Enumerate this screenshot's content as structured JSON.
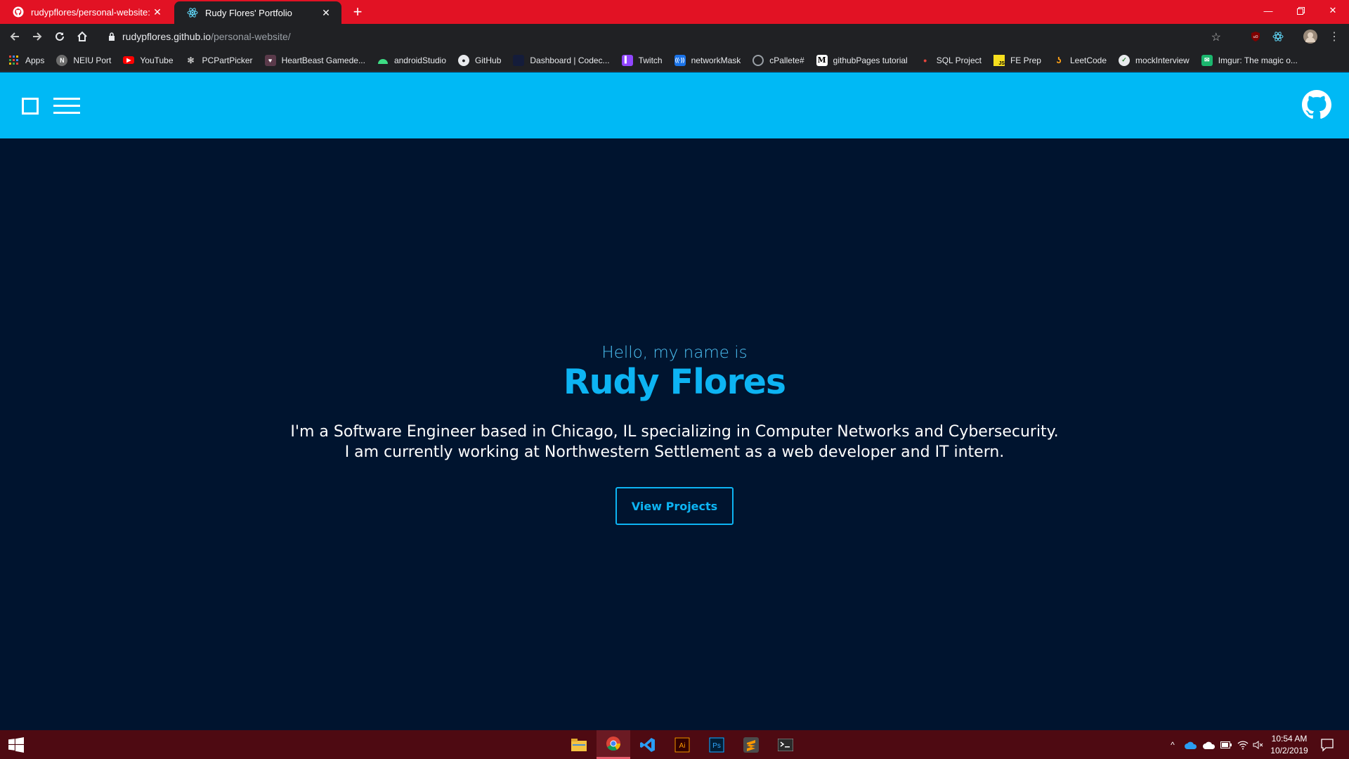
{
  "browser": {
    "tabs": [
      {
        "title": "rudypflores/personal-website: Pe",
        "favicon": "github-icon",
        "active": false
      },
      {
        "title": "Rudy Flores' Portfolio",
        "favicon": "react-icon",
        "active": true
      }
    ],
    "url_host": "rudypflores.github.io",
    "url_path": "/personal-website/",
    "bookmarks": [
      {
        "label": "Apps",
        "icon": "apps-grid-icon",
        "color": "#4285f4"
      },
      {
        "label": "NEIU Port",
        "icon": "neiu-icon",
        "color": "#9aa0a6"
      },
      {
        "label": "YouTube",
        "icon": "youtube-icon",
        "color": "#ff0000"
      },
      {
        "label": "PCPartPicker",
        "icon": "pcpartpicker-icon",
        "color": "#9aa0a6"
      },
      {
        "label": "HeartBeast Gamede...",
        "icon": "heartbeast-icon",
        "color": "#c0a0b0"
      },
      {
        "label": "androidStudio",
        "icon": "android-icon",
        "color": "#3ddc84"
      },
      {
        "label": "GitHub",
        "icon": "github-icon",
        "color": "#ffffff"
      },
      {
        "label": "Dashboard | Codec...",
        "icon": "codecademy-icon",
        "color": "#202124"
      },
      {
        "label": "Twitch",
        "icon": "twitch-icon",
        "color": "#9146ff"
      },
      {
        "label": "networkMask",
        "icon": "networkmask-icon",
        "color": "#1a73e8"
      },
      {
        "label": "cPallete#",
        "icon": "cpallete-icon",
        "color": "#9aa0a6"
      },
      {
        "label": "githubPages tutorial",
        "icon": "medium-icon",
        "color": "#ffffff"
      },
      {
        "label": "SQL Project",
        "icon": "sql-icon",
        "color": "#e8453c"
      },
      {
        "label": "FE Prep",
        "icon": "js-icon",
        "color": "#f7df1e"
      },
      {
        "label": "LeetCode",
        "icon": "leetcode-icon",
        "color": "#ffa116"
      },
      {
        "label": "mockInterview",
        "icon": "check-icon",
        "color": "#4caf50"
      },
      {
        "label": "Imgur: The magic o...",
        "icon": "imgur-icon",
        "color": "#1bb76e"
      }
    ]
  },
  "hero": {
    "greeting": "Hello, my name is",
    "name": "Rudy Flores",
    "bio_line1": "I'm a Software Engineer based in Chicago, IL specializing in Computer Networks and Cybersecurity.",
    "bio_line2": "I am currently working at Northwestern Settlement as a web developer and IT intern.",
    "button_label": "View Projects"
  },
  "taskbar": {
    "apps": [
      "file-explorer-icon",
      "chrome-icon",
      "vscode-icon",
      "illustrator-icon",
      "photoshop-icon",
      "sublime-icon",
      "terminal-icon"
    ],
    "time": "10:54 AM",
    "date": "10/2/2019"
  },
  "colors": {
    "tabstrip": "#e21224",
    "header": "#00b9f5",
    "hero_bg": "#00142f",
    "accent": "#0db4f3",
    "taskbar": "#4e0a12"
  }
}
